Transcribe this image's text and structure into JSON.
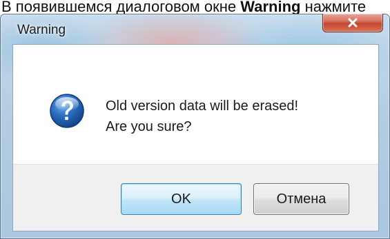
{
  "background_text": {
    "before": "В появившемся диалоговом окне ",
    "bold": "Warning",
    "after": " нажмите"
  },
  "window": {
    "title": "Warning",
    "close_glyph": "x"
  },
  "message": {
    "line1": "Old version data will be erased!",
    "line2": "Are you sure?",
    "icon": "question-icon"
  },
  "buttons": {
    "ok_label": "OK",
    "cancel_label": "Отмена"
  },
  "colors": {
    "close_button": "#c4452e",
    "icon_blue": "#1f5fb0",
    "ok_border": "#3c7fb1"
  }
}
